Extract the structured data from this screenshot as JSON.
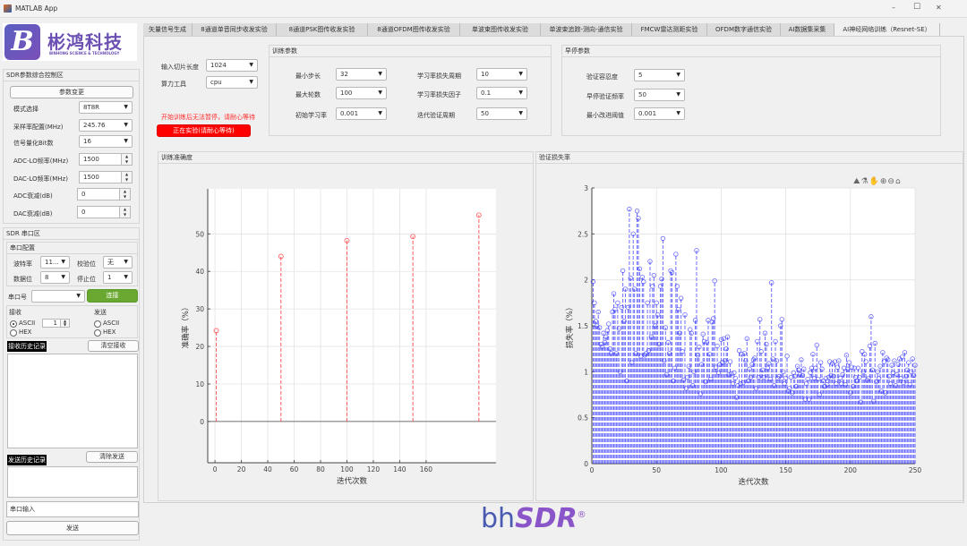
{
  "window": {
    "title": "MATLAB App",
    "minimize": "–",
    "maximize": "☐",
    "close": "✕"
  },
  "logo": {
    "cn": "彬鸿科技",
    "en": "BINHONG SCIENCE & TECHNOLOGY",
    "letter": "B"
  },
  "tabs": [
    {
      "label": "矢量信号生成"
    },
    {
      "label": "8通道单音同步收发实验"
    },
    {
      "label": "8通道PSK图传收发实验"
    },
    {
      "label": "8通道OFDM图传收发实验"
    },
    {
      "label": "单波束图传收发实验"
    },
    {
      "label": "单波束追踪-测向-通信实验"
    },
    {
      "label": "FMCW雷达测距实验"
    },
    {
      "label": "OFDM数字通信实验"
    },
    {
      "label": "AI数据集采集"
    },
    {
      "label": "AI神经网络训练（Resnet-SE）",
      "active": true
    }
  ],
  "sdr_params": {
    "title": "SDR参数综合控制区",
    "change_button": "参数变更",
    "rows": [
      {
        "label": "模式选择",
        "value": "8T8R"
      },
      {
        "label": "采样率配置(MHz)",
        "value": "245.76"
      },
      {
        "label": "信号量化Bit数",
        "value": "16"
      },
      {
        "label": "ADC-LO频率(MHz)",
        "value": "1500"
      },
      {
        "label": "DAC-LO频率(MHz)",
        "value": "1500"
      },
      {
        "label": "ADC衰减(dB)",
        "value": "0"
      },
      {
        "label": "DAC衰减(dB)",
        "value": "0"
      }
    ]
  },
  "serial": {
    "title": "SDR 串口区",
    "config_title": "串口配置",
    "baud_label": "波特率",
    "baud_value": "11...",
    "parity_label": "校验位",
    "parity_value": "无",
    "databits_label": "数据位",
    "databits_value": "8",
    "stopbits_label": "停止位",
    "stopbits_value": "1",
    "port_label": "串口号",
    "port_value": "",
    "connect_button": "连接",
    "connect_color": "#6aa832",
    "receive_label": "接收",
    "send_label": "发送",
    "ascii": "ASCII",
    "hex": "HEX",
    "receive_count": "1",
    "recv_history_label": "接收历史记录",
    "clear_recv_button": "清空接收",
    "send_history_label": "发送历史记录",
    "clear_send_button": "清除发送",
    "input_placeholder": "串口输入",
    "send_button": "发送"
  },
  "main": {
    "slice_label": "输入切片长度",
    "slice_value": "1024",
    "compute_label": "算力工具",
    "compute_value": "cpu",
    "warning": "开始训练后无法暂停，请耐心等待",
    "running_button": "正在实验(请耐心等待)",
    "running_color": "#ff0000",
    "train": {
      "title": "训练参数",
      "rows": [
        {
          "label": "最小步长",
          "value": "32"
        },
        {
          "label": "最大轮数",
          "value": "100"
        },
        {
          "label": "初始学习率",
          "value": "0.001"
        },
        {
          "label": "学习率损失周期",
          "value": "10"
        },
        {
          "label": "学习率损失因子",
          "value": "0.1"
        },
        {
          "label": "迭代验证周期",
          "value": "50"
        }
      ]
    },
    "early": {
      "title": "早停参数",
      "rows": [
        {
          "label": "验证容忍度",
          "value": "5"
        },
        {
          "label": "早停验证频率",
          "value": "50"
        },
        {
          "label": "最小改进阈值",
          "value": "0.001"
        }
      ]
    },
    "acc_panel_title": "训练准确度",
    "loss_panel_title": "验证损失率"
  },
  "chart_data": [
    {
      "type": "stem",
      "title": "训练准确度",
      "xlabel": "迭代次数",
      "ylabel": "准确率（%）",
      "color": "#ff5a5a",
      "xlim": [
        -5.5,
        213
      ],
      "ylim": [
        -11,
        62
      ],
      "xticks": [
        0,
        20,
        40,
        60,
        80,
        100,
        120,
        140,
        160
      ],
      "yticks": [
        0,
        10,
        20,
        30,
        40,
        50
      ],
      "grid": true,
      "x": [
        1,
        50,
        100,
        150,
        200
      ],
      "values": [
        24.2,
        44,
        48.2,
        49.3,
        55
      ]
    },
    {
      "type": "stem",
      "title": "验证损失率",
      "xlabel": "迭代次数",
      "ylabel": "损失率（%）",
      "color": "#3a3aff",
      "xlim": [
        0,
        250
      ],
      "ylim": [
        0,
        3
      ],
      "xticks": [
        0,
        50,
        100,
        150,
        200,
        250
      ],
      "yticks": [
        0,
        0.5,
        1,
        1.5,
        2,
        2.5,
        3
      ],
      "grid": true,
      "x_start": 1,
      "x_step": 1,
      "values": [
        1.98,
        1.75,
        1.55,
        1.5,
        1.65,
        1.48,
        1.3,
        1.27,
        1.42,
        1.32,
        1.38,
        1.45,
        1.52,
        1.25,
        1.2,
        1.65,
        1.85,
        1.68,
        1.2,
        1.75,
        1.47,
        1.0,
        1.7,
        2.1,
        1.55,
        1.9,
        0.9,
        1.7,
        2.77,
        2.02,
        1.1,
        2.5,
        1.9,
        1.2,
        2.75,
        2.67,
        2.12,
        1.17,
        2.03,
        1.98,
        1.18,
        1.2,
        1.75,
        1.23,
        2.2,
        1.38,
        1.93,
        2.05,
        1.5,
        1.75,
        1.62,
        1.3,
        1.93,
        2.01,
        2.45,
        1.12,
        1.48,
        0.97,
        1.32,
        1.2,
        2.1,
        2.08,
        0.9,
        1.04,
        2.28,
        1.93,
        1.68,
        1.42,
        1.8,
        1.22,
        0.91,
        1.62,
        0.82,
        0.94,
        1.06,
        1.46,
        1.42,
        0.85,
        1.0,
        1.56,
        2.32,
        1.18,
        1.27,
        0.76,
        1.08,
        1.41,
        1.33,
        0.89,
        1.32,
        1.56,
        1.19,
        0.92,
        1.54,
        1.58,
        1.99,
        1.05,
        1.28,
        0.99,
        1.08,
        1.35,
        1.1,
        1.36,
        1.12,
        1.25,
        1.38,
        0.97,
        1.11,
        0.98,
        0.87,
        0.99,
        0.93,
        0.72,
        0.85,
        1.23,
        0.87,
        1.19,
        0.88,
        1.2,
        1.12,
        1.36,
        0.9,
        1.03,
        0.94,
        1.08,
        1.13,
        1.15,
        0.82,
        1.33,
        0.94,
        1.57,
        1.22,
        1.02,
        0.94,
        1.42,
        1.3,
        1.04,
        1.09,
        0.92,
        1.97,
        1.14,
        0.85,
        1.33,
        1.12,
        0.93,
        0.95,
        1.5,
        1.57,
        1.0,
        0.87,
        0.93,
        1.17,
        0.79,
        0.82,
        0.94,
        0.77,
        0.99,
        0.95,
        0.84,
        1.06,
        1.02,
        0.97,
        1.13,
        0.96,
        1.03,
        0.7,
        0.87,
        0.92,
        0.7,
        0.99,
        1.04,
        1.19,
        0.93,
        1.04,
        1.29,
        0.92,
        0.75,
        1.1,
        1.03,
        0.9,
        0.84,
        0.93,
        0.86,
        0.94,
        1.11,
        0.96,
        1.09,
        0.95,
        1.11,
        0.87,
        1.05,
        1.12,
        0.93,
        0.87,
        0.97,
        1.04,
        0.86,
        1.18,
        1.03,
        1.1,
        0.77,
        1.05,
        0.84,
        1.04,
        0.94,
        0.9,
        1.04,
        0.94,
        0.67,
        1.22,
        1.0,
        1.19,
        1.11,
        0.91,
        0.93,
        1.28,
        1.6,
        1.02,
        0.68,
        1.31,
        0.89,
        1.0,
        0.93,
        1.06,
        0.79,
        1.21,
        1.11,
        0.77,
        1.15,
        1.13,
        0.95,
        0.87,
        1.07,
        0.99,
        1.12,
        0.85,
        0.97,
        1.08,
        1.14,
        0.93,
        1.16,
        0.88,
        1.21,
        0.95,
        1.02,
        1.1,
        0.86,
        1.0,
        1.14,
        0.96,
        1.07
      ]
    }
  ],
  "footer_logo": {
    "prefix": "bh",
    "brand": "SDR",
    "reg": "®"
  }
}
